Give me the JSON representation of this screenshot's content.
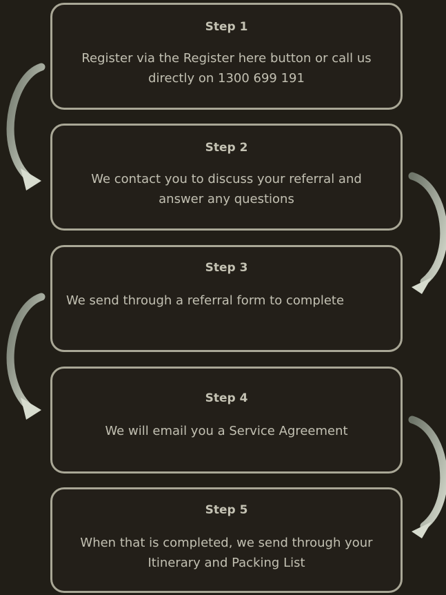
{
  "colors": {
    "background": "#211e17",
    "box_border": "#a9a796",
    "text": "#c2c0b2",
    "arrow": "#b8bfb3"
  },
  "steps": [
    {
      "title": "Step 1",
      "lines": [
        "Register via the Register here button or call us",
        "directly on 1300 699 191"
      ]
    },
    {
      "title": "Step 2",
      "lines": [
        "We contact you to discuss your referral and",
        "answer any questions"
      ]
    },
    {
      "title": "Step 3",
      "lines": [
        "We send through a referral form to complete"
      ]
    },
    {
      "title": "Step 4",
      "lines": [
        "We will email you a Service Agreement"
      ]
    },
    {
      "title": "Step 5",
      "lines": [
        "When that is completed, we send through your",
        "Itinerary and Packing List"
      ]
    }
  ],
  "arrows": [
    {
      "name": "arrow-step1-to-step2",
      "side": "left"
    },
    {
      "name": "arrow-step2-to-step3",
      "side": "right"
    },
    {
      "name": "arrow-step3-to-step4",
      "side": "left"
    },
    {
      "name": "arrow-step4-to-step5",
      "side": "right"
    }
  ]
}
